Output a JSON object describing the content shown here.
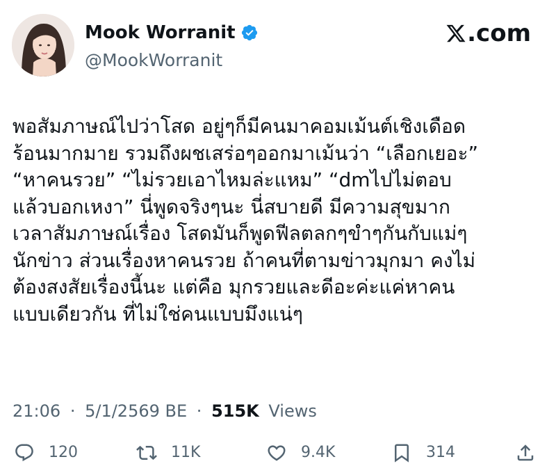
{
  "author": {
    "display_name": "Mook Worranit",
    "handle": "@MookWorranit",
    "verified": true,
    "avatar_icon": "profile-photo"
  },
  "brand": {
    "label": ".com",
    "icon": "x-logo-icon"
  },
  "tweet": {
    "lines": [
      "พอสัมภาษณ์ไปว่าโสด อยู่ๆก็มีคนมาคอมเม้นต์เชิงเดือด",
      "ร้อนมากมาย รวมถึงผชเสร่อๆออกมาเม้นว่า “เลือกเยอะ”",
      "“หาคนรวย”  “ไม่รวยเอาไหมล่ะแหม” “dmไปไม่ตอบ",
      "แล้วบอกเหงา” นี่พูดจริงๆนะ นี่สบายดี มีความสุขมาก",
      "เวลาสัมภาษณ์เรื่อง โสดมันก็พูดฟีลตลกๆขำๆกันกับแม่ๆ",
      "นักข่าว ส่วนเรื่องหาคนรวย ถ้าคนที่ตามข่าวมุกมา คงไม่",
      "ต้องสงสัยเรื่องนี้นะ แต่คือ มุกรวยและดีอะค่ะแค่หาคน",
      "แบบเดียวกัน ที่ไม่ใช่คนแบบมึงแน่ๆ"
    ]
  },
  "meta": {
    "time": "21:06",
    "separator": "·",
    "date": "5/1/2569 BE",
    "views_count": "515K",
    "views_label": "Views"
  },
  "actions": {
    "reply": {
      "icon": "reply-icon",
      "count": "120"
    },
    "repost": {
      "icon": "repost-icon",
      "count": "11K"
    },
    "like": {
      "icon": "like-icon",
      "count": "9.4K"
    },
    "bookmark": {
      "icon": "bookmark-icon",
      "count": "314"
    },
    "share": {
      "icon": "share-icon"
    }
  },
  "colors": {
    "text_primary": "#0f1419",
    "text_secondary": "#536471",
    "verified_badge": "#1d9bf0",
    "background": "#ffffff"
  }
}
